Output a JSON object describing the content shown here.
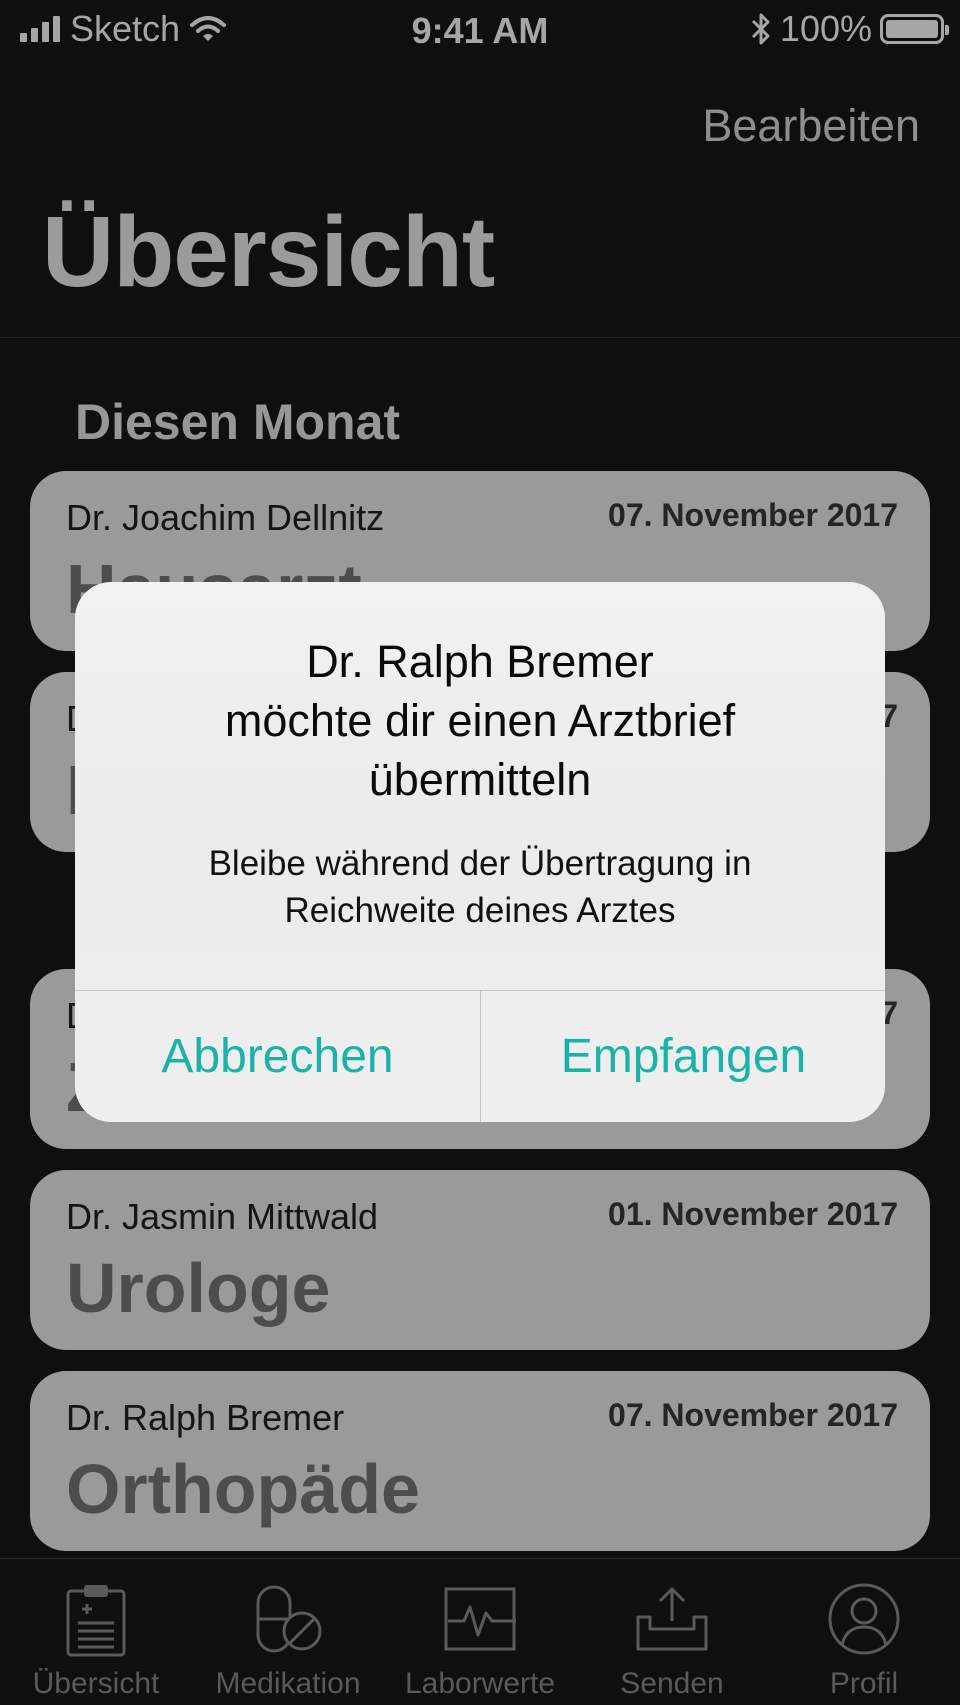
{
  "status_bar": {
    "carrier": "Sketch",
    "time": "9:41 AM",
    "battery": "100%"
  },
  "header": {
    "edit_label": "Bearbeiten",
    "title": "Übersicht"
  },
  "section": {
    "title": "Diesen Monat"
  },
  "cards": [
    {
      "doctor": "Dr. Joachim Dellnitz",
      "date": "07. November 2017",
      "specialty": "Hausarzt"
    },
    {
      "doctor": "Dr.",
      "date": "7",
      "specialty": "I"
    },
    {
      "doctor": "D",
      "date": "7",
      "specialty": "Z"
    },
    {
      "doctor": "Dr. Jasmin Mittwald",
      "date": "01. November 2017",
      "specialty": "Urologe"
    },
    {
      "doctor": "Dr. Ralph Bremer",
      "date": "07. November 2017",
      "specialty": "Orthopäde"
    }
  ],
  "dialog": {
    "title_lines": [
      "Dr. Ralph Bremer",
      "möchte dir einen Arztbrief",
      "übermitteln"
    ],
    "message_lines": [
      "Bleibe während der Übertragung in",
      "Reichweite deines Arztes"
    ],
    "cancel_label": "Abbrechen",
    "confirm_label": "Empfangen",
    "accent_color": "#19b3a9"
  },
  "tabbar": {
    "tabs": [
      {
        "label": "Übersicht",
        "icon": "clipboard-icon"
      },
      {
        "label": "Medikation",
        "icon": "pill-icon"
      },
      {
        "label": "Laborwerte",
        "icon": "pulse-icon"
      },
      {
        "label": "Senden",
        "icon": "upload-tray-icon"
      },
      {
        "label": "Profil",
        "icon": "person-icon"
      }
    ]
  }
}
